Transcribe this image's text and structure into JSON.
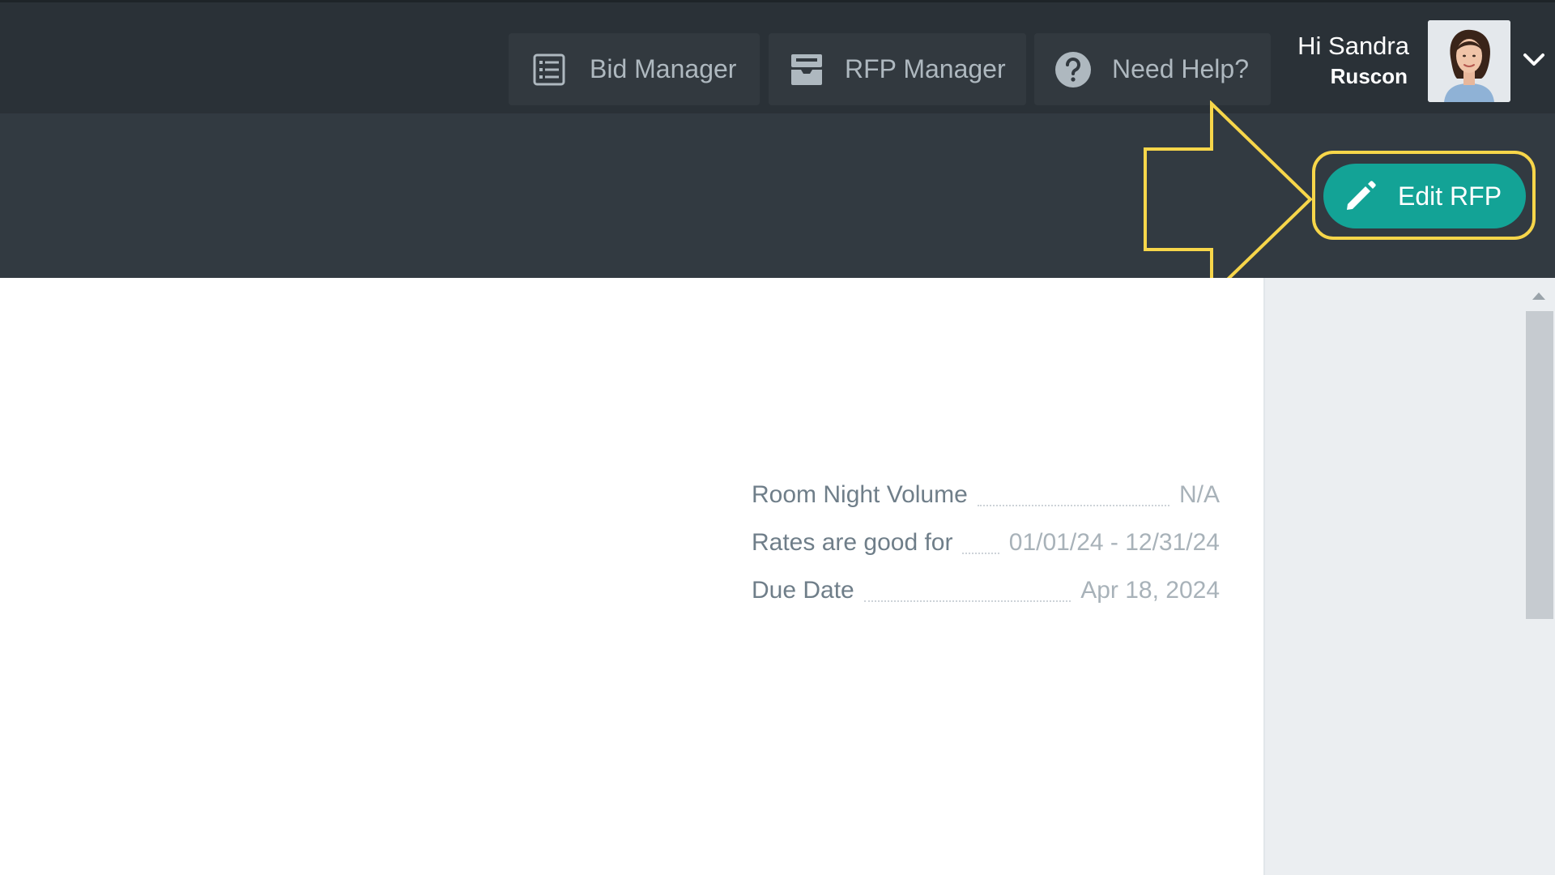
{
  "nav": {
    "bid_manager": {
      "label": "Bid Manager",
      "icon": "list-icon"
    },
    "rfp_manager": {
      "label": "RFP Manager",
      "icon": "inbox-tray-icon"
    },
    "need_help": {
      "label": "Need Help?",
      "icon": "question-circle-icon"
    }
  },
  "user": {
    "greeting": "Hi Sandra",
    "company": "Ruscon"
  },
  "toolbar": {
    "edit_rfp_label": "Edit RFP"
  },
  "rfp_details": [
    {
      "label": "Room Night Volume",
      "value": "N/A"
    },
    {
      "label": "Rates are good for",
      "value": "01/01/24 - 12/31/24"
    },
    {
      "label": "Due Date",
      "value": "Apr 18, 2024"
    }
  ],
  "colors": {
    "topbar": "#2a3137",
    "subbar": "#323a41",
    "accent_teal": "#13a396",
    "highlight_yellow": "#f7d64a"
  }
}
